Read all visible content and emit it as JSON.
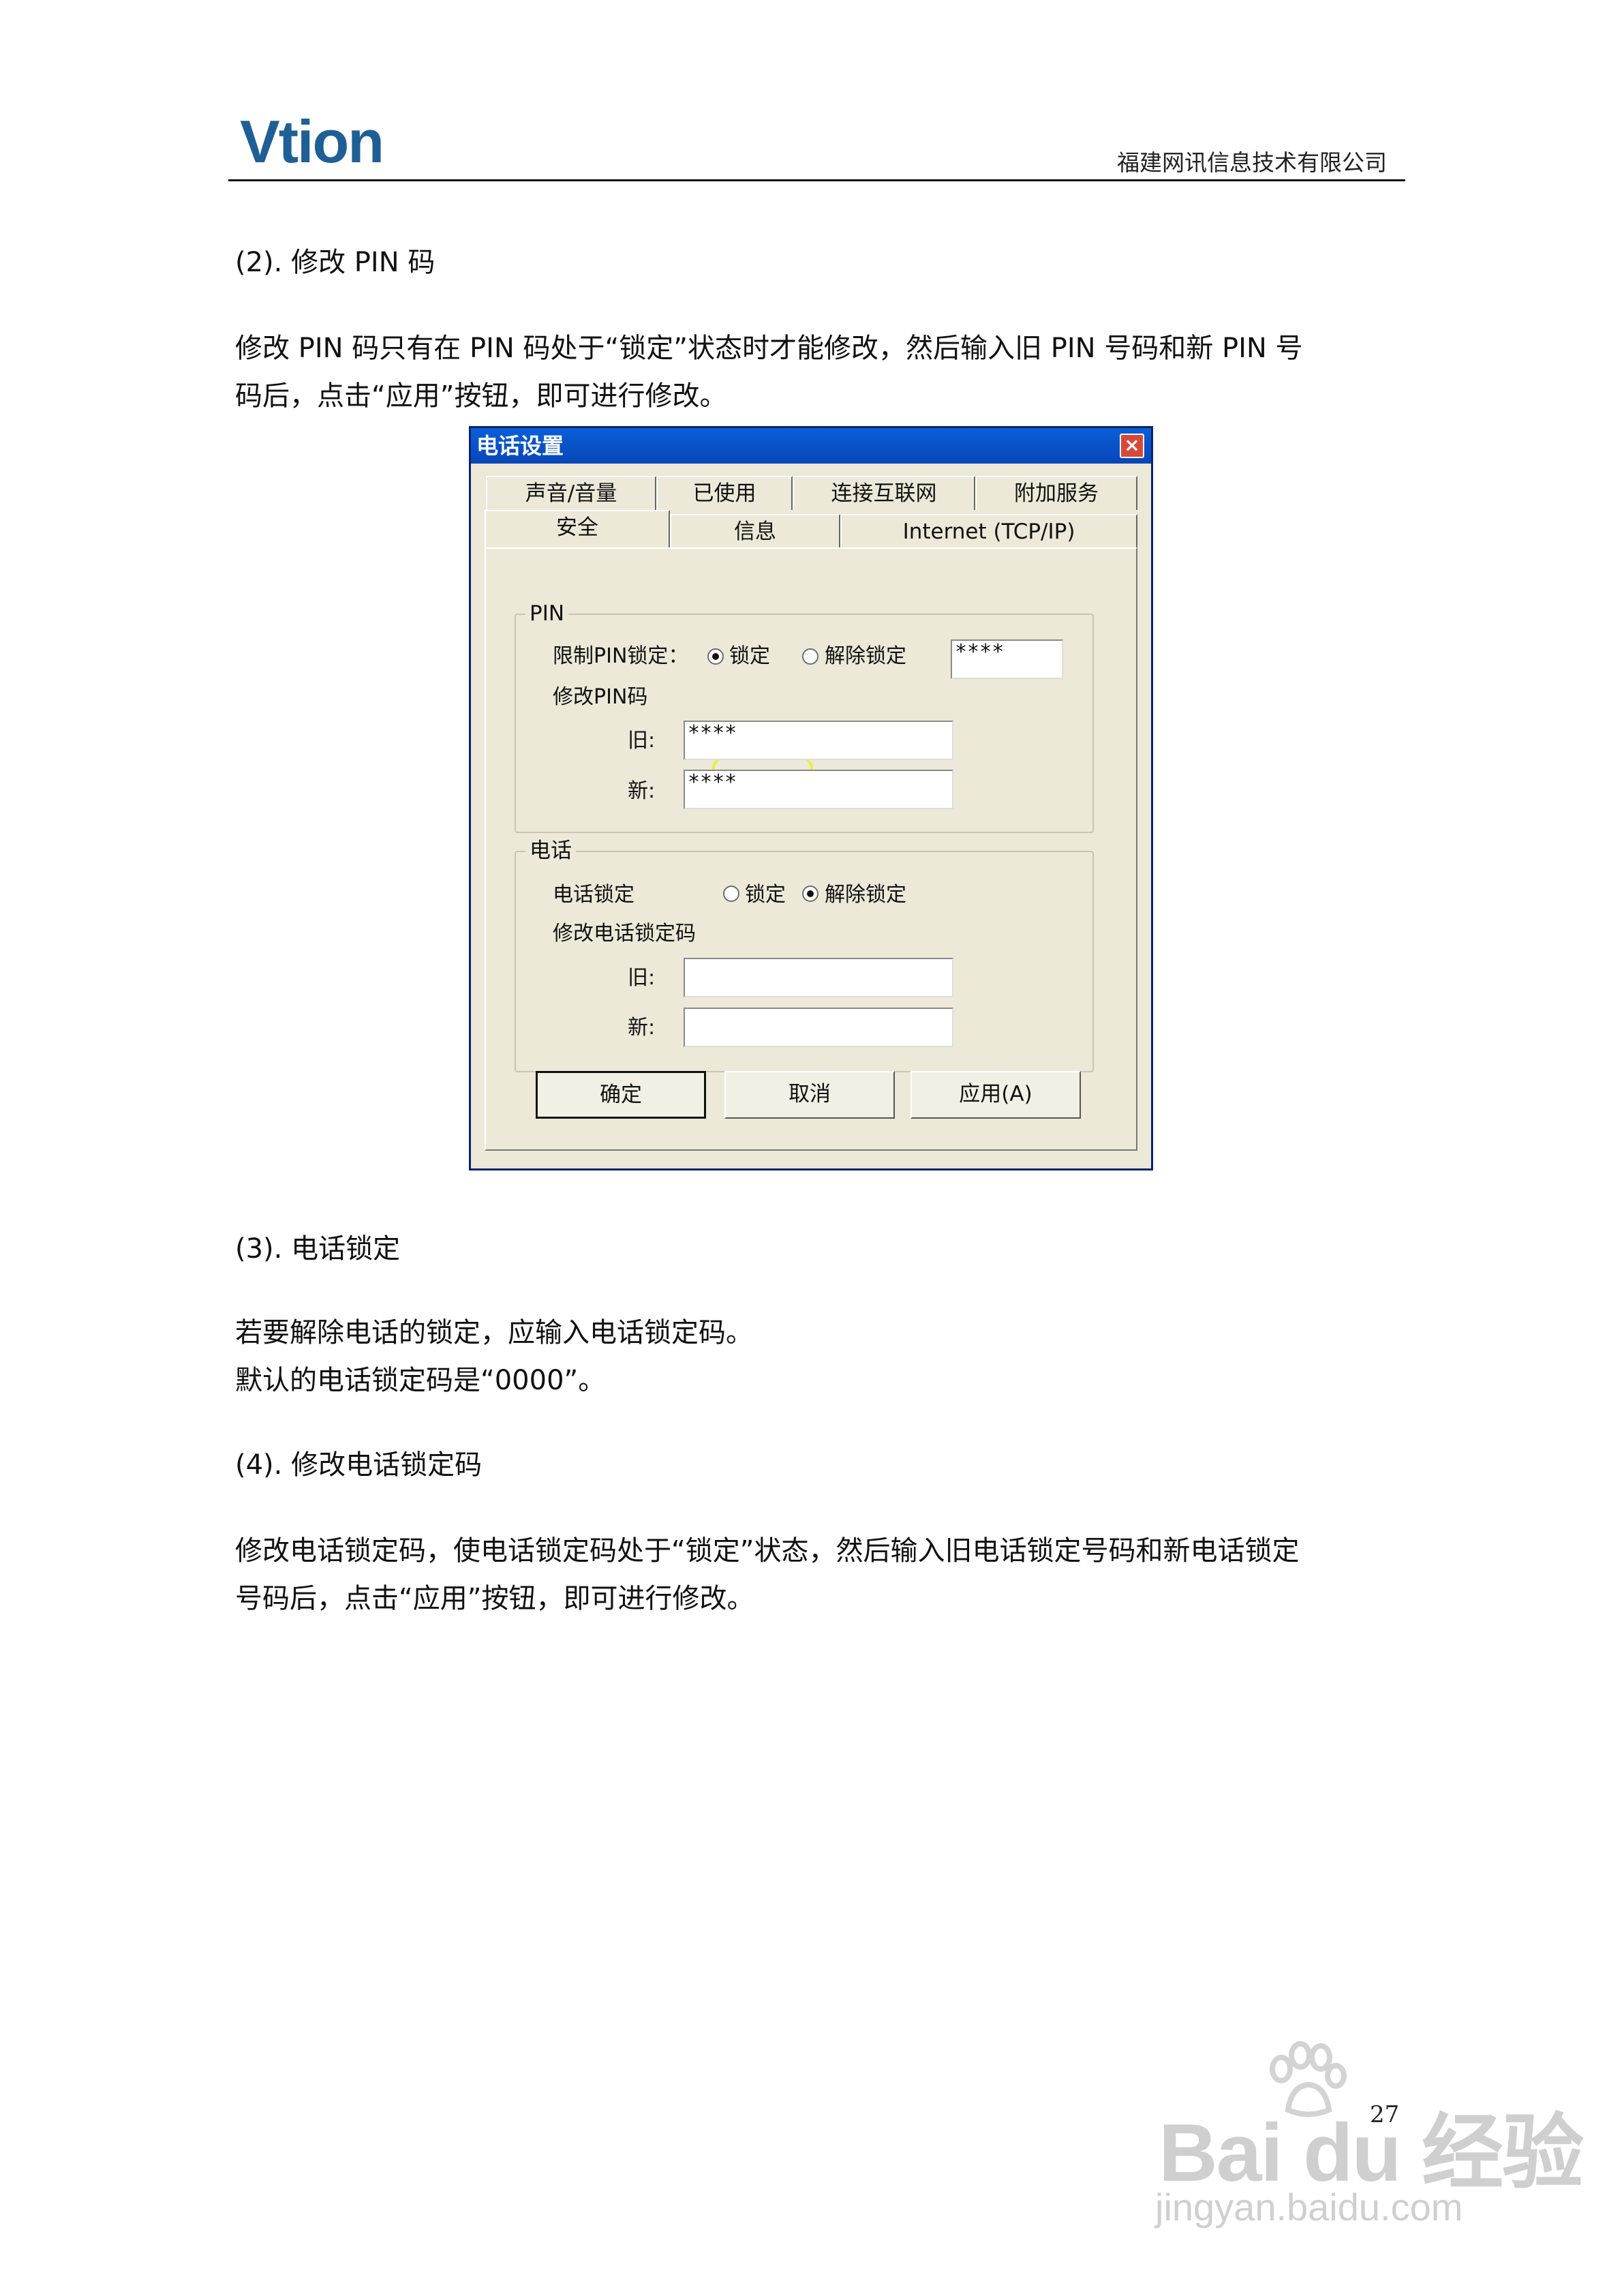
{
  "header": {
    "logo_text": "Vtion",
    "company": "福建网讯信息技术有限公司"
  },
  "content": {
    "heading_change_pin": "(2). 修改 PIN 码",
    "para_change_pin_1": "修改 PIN 码只有在 PIN 码处于“锁定”状态时才能修改，然后输入旧 PIN 号码和新 PIN 号",
    "para_change_pin_2": "码后，点击“应用”按钮，即可进行修改。",
    "heading_phone_lock": "(3). 电话锁定",
    "para_phone_lock_1": "若要解除电话的锁定，应输入电话锁定码。",
    "para_phone_lock_2": "默认的电话锁定码是“0000”。",
    "heading_change_phone_code": "(4). 修改电话锁定码",
    "para_change_phone_code_1": "修改电话锁定码，使电话锁定码处于“锁定”状态，然后输入旧电话锁定号码和新电话锁定",
    "para_change_phone_code_2": "号码后，点击“应用”按钮，即可进行修改。"
  },
  "dialog": {
    "title": "电话设置",
    "close_glyph": "×",
    "tabs_row1": [
      "声音/音量",
      "已使用",
      "连接互联网",
      "附加服务"
    ],
    "tabs_row2": [
      "安全",
      "信息",
      "Internet (TCP/IP)"
    ],
    "selected_tab": "安全",
    "pin_group": {
      "label": "PIN",
      "restrict_label": "限制PIN锁定：",
      "option_lock": "锁定",
      "option_unlock": "解除锁定",
      "selected": "锁定",
      "pin_value": "****",
      "change_label": "修改PIN码",
      "old_label": "旧:",
      "old_value": "****",
      "new_label": "新:",
      "new_value": "****"
    },
    "phone_group": {
      "label": "电话",
      "lock_label": "电话锁定",
      "option_lock": "锁定",
      "option_unlock": "解除锁定",
      "selected": "解除锁定",
      "change_label": "修改电话锁定码",
      "old_label": "旧:",
      "old_value": "",
      "new_label": "新:",
      "new_value": ""
    },
    "buttons": {
      "ok": "确定",
      "cancel": "取消",
      "apply": "应用(A)"
    },
    "highlight_color": "#f1ea3a"
  },
  "footer": {
    "page_number": "27",
    "watermark_main": "Bai du 经验",
    "watermark_url": "jingyan.baidu.com"
  }
}
